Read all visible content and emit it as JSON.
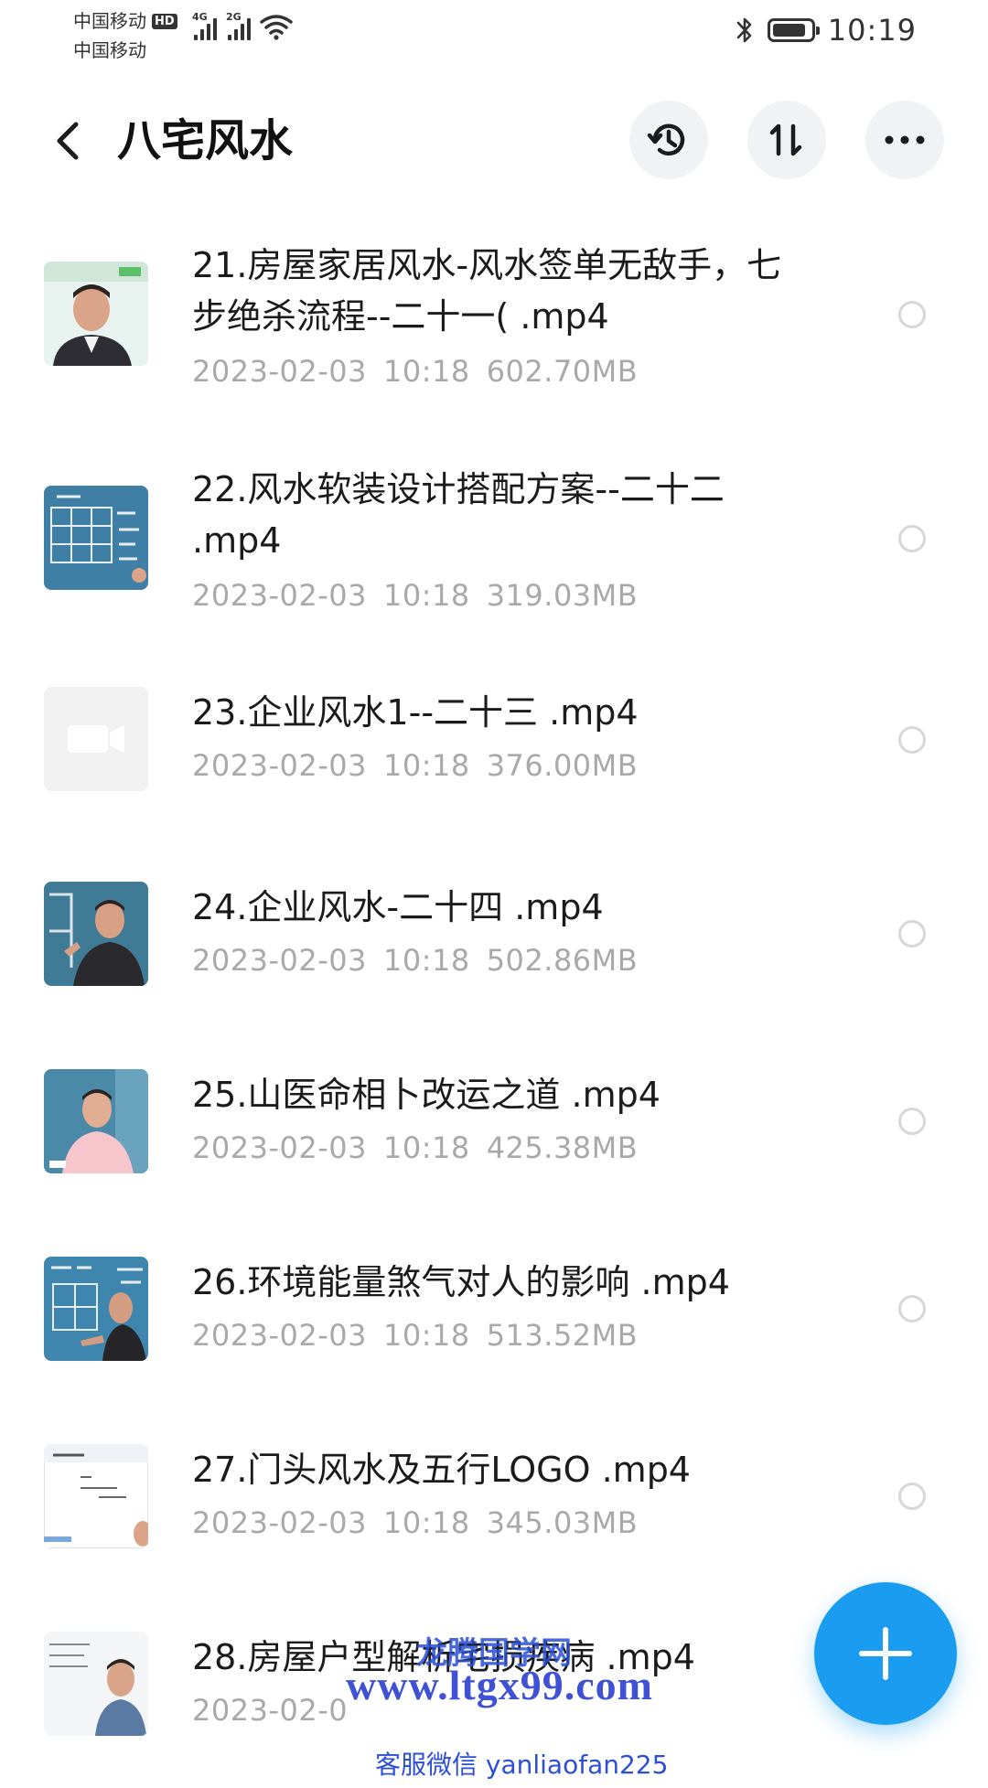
{
  "status_bar": {
    "carrier_1": "中国移动",
    "hd_badge": "HD",
    "carrier_2": "中国移动",
    "signal_1_tag": "4G",
    "signal_2_tag": "2G",
    "time": "10:19"
  },
  "header": {
    "title": "八宅风水",
    "icons": [
      "back-arrow-icon",
      "history-icon",
      "sort-icon",
      "more-icon"
    ]
  },
  "files": [
    {
      "name": "21.房屋家居风水-风水签单无敌手，七步绝杀流程--二十一( .mp4",
      "date": "2023-02-03",
      "time": "10:18",
      "size": "602.70MB",
      "thumb": "teacher-green"
    },
    {
      "name": "22.风水软装设计搭配方案--二十二 .mp4",
      "date": "2023-02-03",
      "time": "10:18",
      "size": "319.03MB",
      "thumb": "blackboard-grid"
    },
    {
      "name": "23.企业风水1--二十三 .mp4",
      "date": "2023-02-03",
      "time": "10:18",
      "size": "376.00MB",
      "thumb": "video-placeholder"
    },
    {
      "name": "24.企业风水-二十四 .mp4",
      "date": "2023-02-03",
      "time": "10:18",
      "size": "502.86MB",
      "thumb": "teacher-board"
    },
    {
      "name": "25.山医命相卜改运之道 .mp4",
      "date": "2023-02-03",
      "time": "10:18",
      "size": "425.38MB",
      "thumb": "teacher-pink"
    },
    {
      "name": "26.环境能量煞气对人的影响 .mp4",
      "date": "2023-02-03",
      "time": "10:18",
      "size": "513.52MB",
      "thumb": "teacher-board-writing"
    },
    {
      "name": "27.门头风水及五行LOGO .mp4",
      "date": "2023-02-03",
      "time": "10:18",
      "size": "345.03MB",
      "thumb": "slide-white"
    },
    {
      "name": "28.房屋户型解析宅损疾病 .mp4",
      "date": "2023-02-0",
      "time": "",
      "size": "",
      "thumb": "teacher-slide"
    }
  ],
  "fab": {
    "icon": "plus-icon"
  },
  "watermark": {
    "line1": "龙腾国学网",
    "line2": "www.ltgx99.com",
    "line3": "客服微信 yanliaofan225"
  },
  "colors": {
    "accent": "#1a9df0",
    "meta_text": "#a9a9a9",
    "watermark": "#2b4fd8"
  }
}
